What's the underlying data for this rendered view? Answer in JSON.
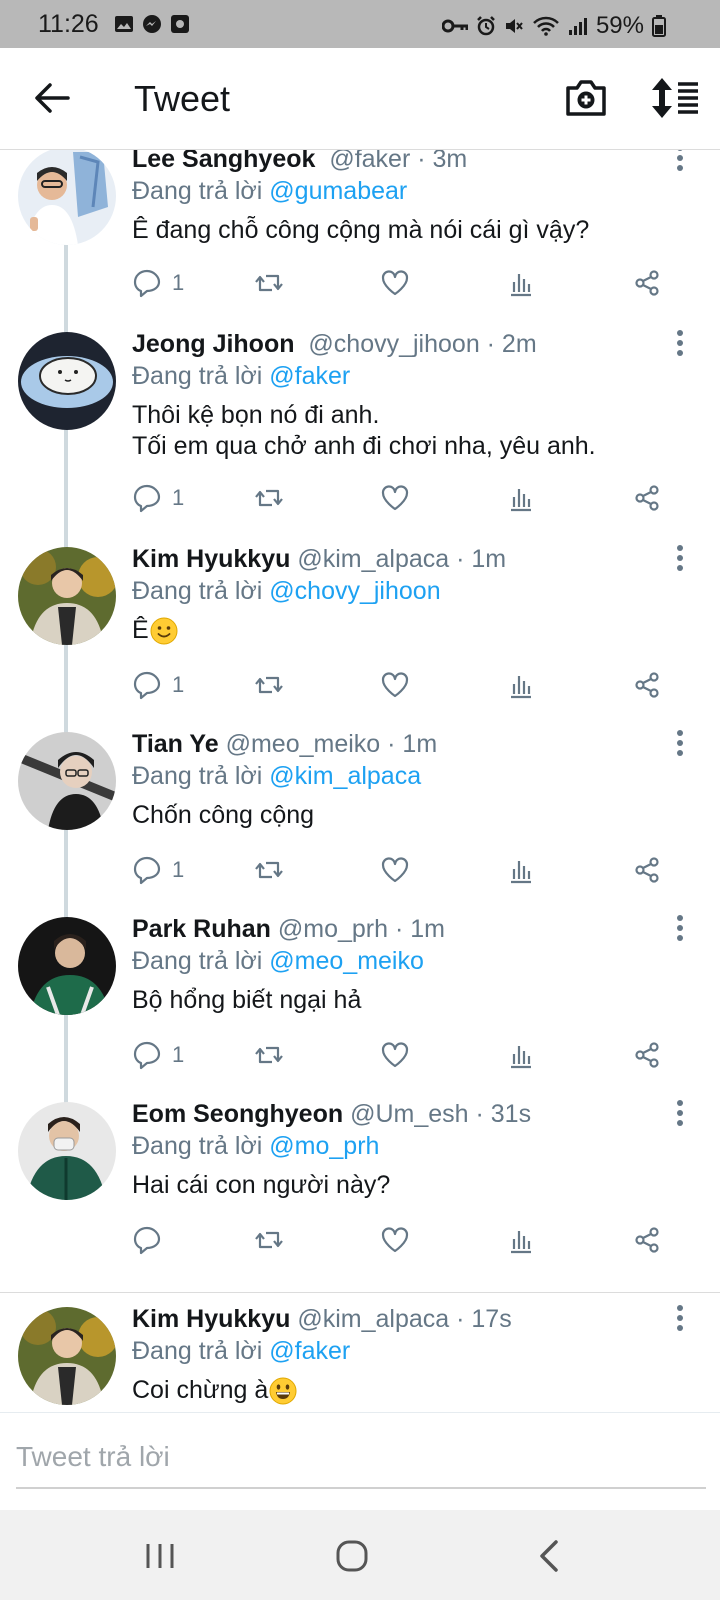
{
  "status_bar": {
    "time": "11:26",
    "battery": "59%"
  },
  "header": {
    "title": "Tweet"
  },
  "tweets": [
    {
      "name": "Lee Sanghyeok",
      "handle": "@faker · 3m",
      "reply_prefix": "Đang trả lời ",
      "reply_to": "@gumabear",
      "text": "Ê đang chỗ công cộng mà nói cái gì vậy?",
      "reply_count": "1"
    },
    {
      "name": "Jeong Jihoon",
      "handle": "@chovy_jihoon · 2m",
      "reply_prefix": "Đang trả lời ",
      "reply_to": "@faker",
      "text": "Thôi kệ bọn nó đi anh.\nTối em qua chở anh đi chơi nha, yêu anh.",
      "reply_count": "1"
    },
    {
      "name": "Kim Hyukkyu",
      "handle": "@kim_alpaca · 1m",
      "reply_prefix": "Đang trả lời ",
      "reply_to": "@chovy_jihoon",
      "text": "Ê",
      "emoji": "slightly-smiling-face",
      "reply_count": "1"
    },
    {
      "name": "Tian Ye",
      "handle": "@meo_meiko · 1m",
      "reply_prefix": "Đang trả lời ",
      "reply_to": "@kim_alpaca",
      "text": "Chốn công cộng",
      "reply_count": "1"
    },
    {
      "name": "Park Ruhan",
      "handle": "@mo_prh · 1m",
      "reply_prefix": "Đang trả lời ",
      "reply_to": "@meo_meiko",
      "text": "Bộ hổng biết ngại hả",
      "reply_count": "1"
    },
    {
      "name": "Eom Seonghyeon",
      "handle": "@Um_esh · 31s",
      "reply_prefix": "Đang trả lời ",
      "reply_to": "@mo_prh",
      "text": "Hai cái con người này?",
      "reply_count": ""
    },
    {
      "name": "Kim Hyukkyu",
      "handle": "@kim_alpaca · 17s",
      "reply_prefix": "Đang trả lời ",
      "reply_to": "@faker",
      "text": "Coi chừng à",
      "emoji": "grinning-face",
      "reply_count": ""
    }
  ],
  "composer": {
    "placeholder": "Tweet trả lời"
  },
  "colors": {
    "link": "#1da1f2",
    "muted": "#657786",
    "status_bar": "#b8b8b8",
    "thread_line": "#cfd9de"
  }
}
